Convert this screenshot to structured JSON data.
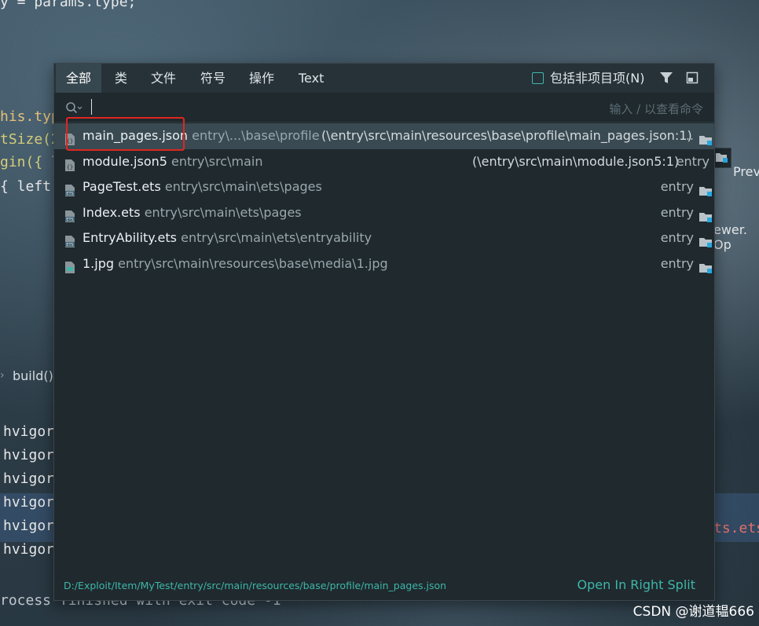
{
  "editor": {
    "line_top": "y = params.type;",
    "line1": "his.typ",
    "line2": "tSize(2",
    "line3": "gin({ l",
    "line4": "{ left",
    "build": "build()",
    "hvigor": [
      "hvigor",
      "hvigor",
      "hvigor",
      "hvigor",
      "hvigor",
      "hvigor"
    ],
    "red_frag": "ts.ets",
    "process": "rocess finished with exit code -1",
    "right_prev": "Prev",
    "right_viewer": "ewer. Op"
  },
  "popup": {
    "tabs": [
      "全部",
      "类",
      "文件",
      "符号",
      "操作",
      "Text"
    ],
    "active_tab": 0,
    "include_non_project": "包括非项目项(N)",
    "search": {
      "value": "",
      "placeholder": "输入 / 以查看命令"
    },
    "results": [
      {
        "name": "main_pages.json",
        "path": "entry\\...\\base\\profile",
        "rpath": "(\\entry\\src\\main\\resources\\base\\profile\\main_pages.json:1)",
        "module": "...",
        "icon": "json-file-icon"
      },
      {
        "name": "module.json5",
        "path": "entry\\src\\main",
        "rpath": "(\\entry\\src\\main\\module.json5:1)",
        "module": "entry",
        "icon": "json-file-icon"
      },
      {
        "name": "PageTest.ets",
        "path": "entry\\src\\main\\ets\\pages",
        "rpath": "",
        "module": "entry",
        "icon": "ets-file-icon"
      },
      {
        "name": "Index.ets",
        "path": "entry\\src\\main\\ets\\pages",
        "rpath": "",
        "module": "entry",
        "icon": "ets-file-icon"
      },
      {
        "name": "EntryAbility.ets",
        "path": "entry\\src\\main\\ets\\entryability",
        "rpath": "",
        "module": "entry",
        "icon": "ets-file-icon"
      },
      {
        "name": "1.jpg",
        "path": "entry\\src\\main\\resources\\base\\media\\1.jpg",
        "rpath": "",
        "module": "entry",
        "icon": "image-file-icon"
      }
    ],
    "footer_path": "D:/Exploit/Item/MyTest/entry/src/main/resources/base/profile/main_pages.json",
    "open_split": "Open In Right Split"
  },
  "watermark": "CSDN @谢道韫666",
  "colors": {
    "accent": "#3fb6a8",
    "highlight_box": "#e0261f",
    "selected_row": "#394a52"
  }
}
